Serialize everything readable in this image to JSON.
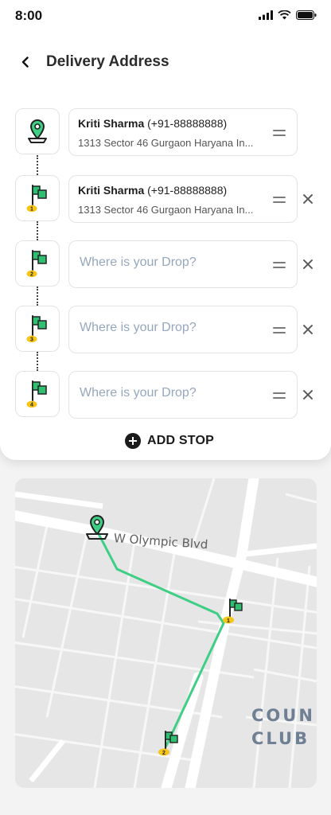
{
  "status_bar": {
    "time": "8:00",
    "icons": [
      "signal-icon",
      "wifi-icon",
      "battery-icon"
    ]
  },
  "header": {
    "title": "Delivery Address",
    "back_icon": "chevron-left-icon"
  },
  "stops": [
    {
      "type": "pickup",
      "icon": "location-pin-icon",
      "name": "Kriti Sharma",
      "phone": "(+91-88888888)",
      "address": "1313 Sector 46 Gurgaon Haryana In...",
      "removable": false
    },
    {
      "type": "drop",
      "icon": "flag-icon",
      "index": "1",
      "name": "Kriti Sharma",
      "phone": "(+91-88888888)",
      "address": "1313 Sector 46 Gurgaon Haryana In...",
      "removable": true
    },
    {
      "type": "drop",
      "icon": "flag-icon",
      "index": "2",
      "placeholder": "Where is your Drop?",
      "removable": true
    },
    {
      "type": "drop",
      "icon": "flag-icon",
      "index": "3",
      "placeholder": "Where is your Drop?",
      "removable": true
    },
    {
      "type": "drop",
      "icon": "flag-icon",
      "index": "4",
      "placeholder": "Where is your Drop?",
      "removable": true
    }
  ],
  "add_stop": {
    "label": "ADD STOP",
    "icon": "plus-circle-icon"
  },
  "map": {
    "street_label": "W Olympic Blvd",
    "area_label": "COUN\nCLUB P",
    "markers": [
      {
        "icon": "location-pin-icon"
      },
      {
        "icon": "flag-icon",
        "index": "1"
      },
      {
        "icon": "flag-icon",
        "index": "2"
      }
    ]
  },
  "colors": {
    "accent_green": "#3ecf85",
    "flag_green": "#2fbf71",
    "badge_yellow": "#f5c518",
    "placeholder": "#95a7bd",
    "route": "#3ecf85"
  }
}
